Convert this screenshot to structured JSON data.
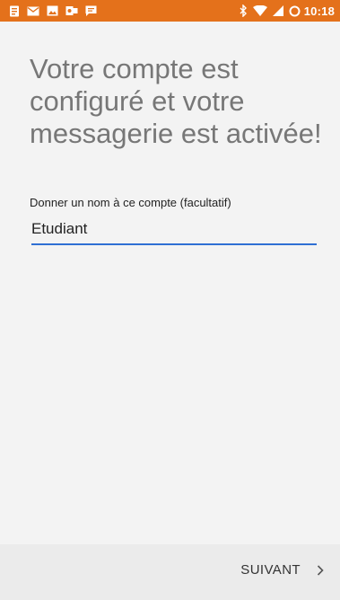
{
  "status_bar": {
    "time": "10:18",
    "color": "#e4711b",
    "left_icons": [
      "notes-icon",
      "email-icon",
      "image-icon",
      "outlook-icon",
      "chat-icon"
    ],
    "right_icons": [
      "bluetooth-icon",
      "wifi-icon",
      "signal-icon",
      "battery-ring-icon"
    ]
  },
  "main": {
    "heading_lines": [
      "Votre compte est",
      "configuré et votre",
      "messagerie est activée!"
    ],
    "account_name_label": "Donner un nom à ce compte (facultatif)",
    "account_name_value": "Etudiant",
    "accent_color": "#2f6fd3"
  },
  "footer": {
    "next_label": "SUIVANT"
  }
}
